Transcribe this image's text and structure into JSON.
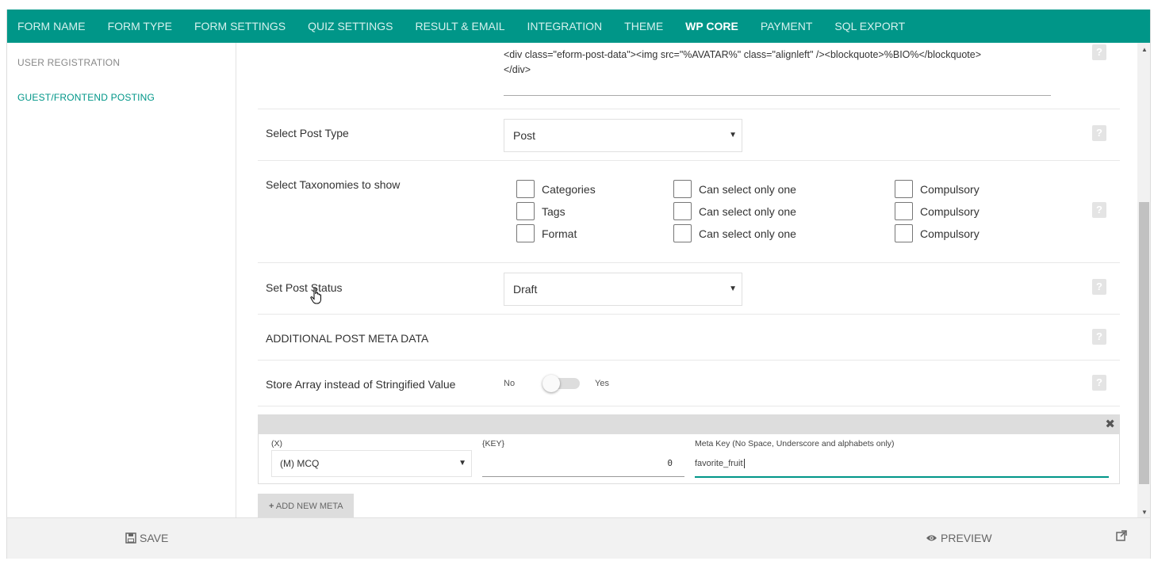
{
  "nav": {
    "tabs": [
      {
        "label": "FORM NAME"
      },
      {
        "label": "FORM TYPE"
      },
      {
        "label": "FORM SETTINGS"
      },
      {
        "label": "QUIZ SETTINGS"
      },
      {
        "label": "RESULT & EMAIL"
      },
      {
        "label": "INTEGRATION"
      },
      {
        "label": "THEME"
      },
      {
        "label": "WP CORE"
      },
      {
        "label": "PAYMENT"
      },
      {
        "label": "SQL EXPORT"
      }
    ],
    "active": "WP CORE"
  },
  "sidebar": {
    "items": [
      {
        "label": "USER REGISTRATION"
      },
      {
        "label": "GUEST/FRONTEND POSTING"
      }
    ]
  },
  "main": {
    "template_code": "<div class=\"eform-post-data\"><img src=\"%AVATAR%\" class=\"alignleft\" /><blockquote>%BIO%</blockquote>",
    "template_code_2": "</div>",
    "post_type": {
      "label": "Select Post Type",
      "value": "Post"
    },
    "taxonomies": {
      "label": "Select Taxonomies to show",
      "rows": [
        {
          "name": "Categories",
          "single": "Can select only one",
          "compulsory": "Compulsory"
        },
        {
          "name": "Tags",
          "single": "Can select only one",
          "compulsory": "Compulsory"
        },
        {
          "name": "Format",
          "single": "Can select only one",
          "compulsory": "Compulsory"
        }
      ]
    },
    "post_status": {
      "label": "Set Post Status",
      "value": "Draft"
    },
    "additional_meta": {
      "label": "ADDITIONAL POST META DATA"
    },
    "store_array": {
      "label": "Store Array instead of Stringified Value",
      "no": "No",
      "yes": "Yes",
      "enabled": false
    },
    "meta_entry": {
      "col1_label": "(X)",
      "col1_value": "(M) MCQ",
      "col2_label": "{KEY}",
      "col2_value": "0",
      "col3_label": "Meta Key (No Space, Underscore and alphabets only)",
      "col3_value": "favorite_fruit"
    },
    "add_meta_label": "ADD NEW META"
  },
  "footer": {
    "save_label": "SAVE",
    "preview_label": "PREVIEW"
  },
  "icons": {
    "help": "question-icon",
    "close": "close-icon",
    "save": "floppy-icon",
    "preview": "eye-icon",
    "external": "external-link-icon",
    "plus": "plus-icon"
  },
  "colors": {
    "accent": "#009688",
    "accent_text": "#d6f1ee",
    "footer_bg": "#f2f2f2"
  }
}
